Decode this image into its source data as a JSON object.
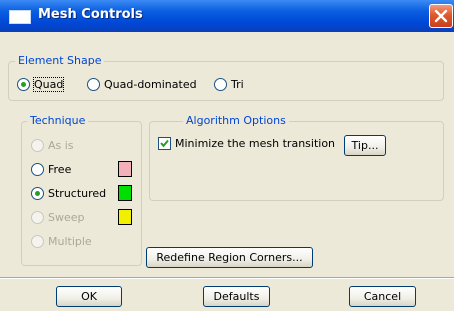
{
  "window": {
    "title": "Mesh Controls",
    "icon": "window-icon",
    "close_icon": "close-icon"
  },
  "element_shape": {
    "legend": "Element Shape",
    "options": [
      {
        "label": "Quad",
        "checked": true
      },
      {
        "label": "Quad-dominated",
        "checked": false
      },
      {
        "label": "Tri",
        "checked": false
      }
    ]
  },
  "technique": {
    "legend": "Technique",
    "options": [
      {
        "label": "As is",
        "checked": false,
        "enabled": false
      },
      {
        "label": "Free",
        "checked": false,
        "enabled": true,
        "color": "#f4b0b8"
      },
      {
        "label": "Structured",
        "checked": true,
        "enabled": true,
        "color": "#00e000"
      },
      {
        "label": "Sweep",
        "checked": false,
        "enabled": false,
        "color": "#f0f000"
      },
      {
        "label": "Multiple",
        "checked": false,
        "enabled": false
      }
    ]
  },
  "algorithm": {
    "legend": "Algorithm Options",
    "minimize_label": "Minimize the mesh transition",
    "minimize_checked": true,
    "tip_label": "Tip..."
  },
  "redefine_label": "Redefine Region Corners...",
  "buttons": {
    "ok": "OK",
    "defaults": "Defaults",
    "cancel": "Cancel"
  },
  "colors": {
    "title_bar": "#0a5ee0",
    "legend_text": "#0046d5",
    "dialog_bg": "#ece9d8"
  }
}
